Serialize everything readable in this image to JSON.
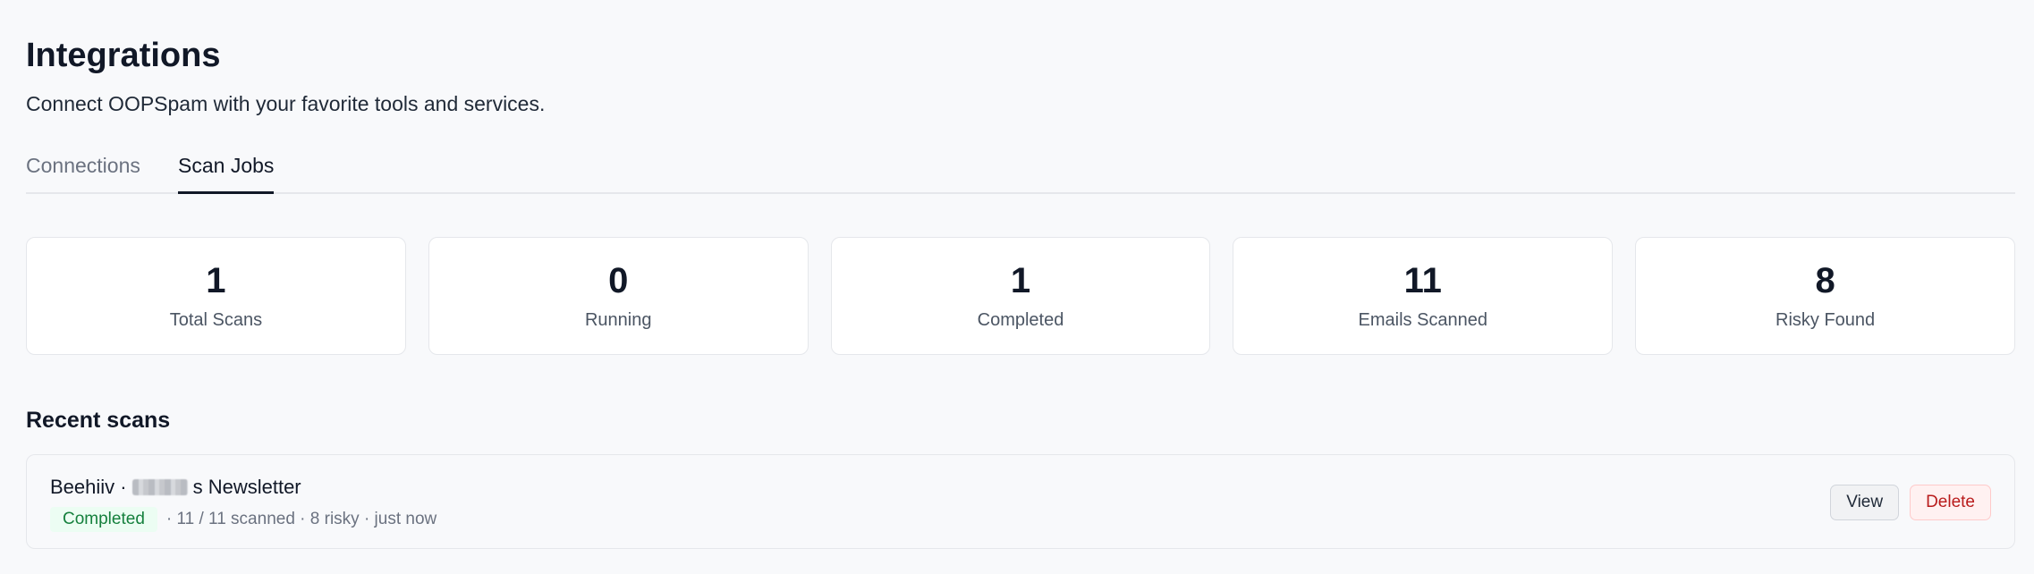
{
  "header": {
    "title": "Integrations",
    "subtitle": "Connect OOPSpam with your favorite tools and services."
  },
  "tabs": [
    {
      "label": "Connections",
      "active": false
    },
    {
      "label": "Scan Jobs",
      "active": true
    }
  ],
  "stats": [
    {
      "value": "1",
      "label": "Total Scans"
    },
    {
      "value": "0",
      "label": "Running"
    },
    {
      "value": "1",
      "label": "Completed"
    },
    {
      "value": "11",
      "label": "Emails Scanned"
    },
    {
      "value": "8",
      "label": "Risky Found"
    }
  ],
  "recent": {
    "title": "Recent scans",
    "items": [
      {
        "source": "Beehiiv ·",
        "name_suffix": "s Newsletter",
        "status": "Completed",
        "details": "· 11 / 11 scanned · 8 risky · just now",
        "view_label": "View",
        "delete_label": "Delete"
      }
    ]
  },
  "colors": {
    "background": "#f8f9fb",
    "status_completed": "#15803d",
    "delete_accent": "#b91c1c"
  }
}
